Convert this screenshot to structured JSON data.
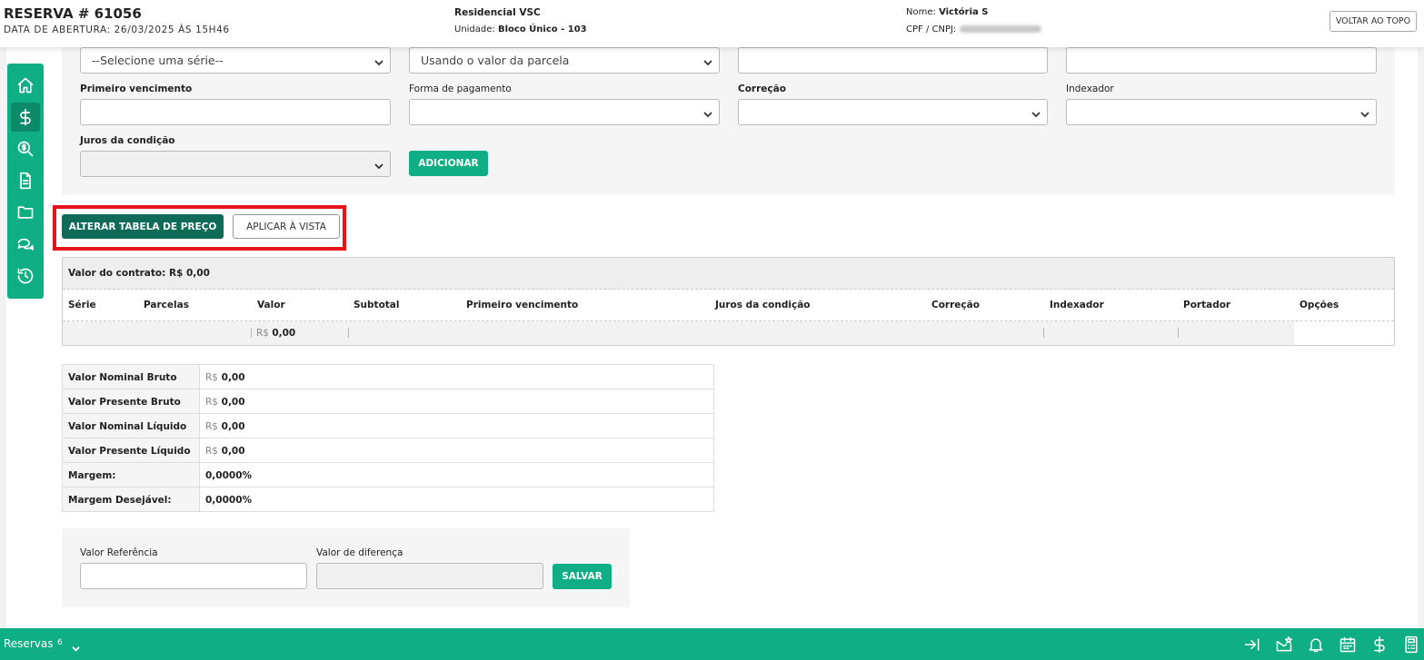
{
  "header": {
    "reserva_title": "RESERVA # 61056",
    "abertura": "DATA DE ABERTURA: 26/03/2025 ÀS 15H46",
    "empreendimento": "Residencial VSC",
    "unidade_label": "Unidade:",
    "unidade_value": "Bloco Único - 103",
    "nome_label": "Nome:",
    "nome_value": "Victória S",
    "cpf_label": "CPF / CNPJ:",
    "top_button": "VOLTAR AO TOPO"
  },
  "form": {
    "serie_select": "--Selecione uma série--",
    "valor_select": "Usando o valor da parcela",
    "primeiro_vencimento_label": "Primeiro vencimento",
    "forma_pagamento_label": "Forma de pagamento",
    "correcao_label": "Correção",
    "indexador_label": "Indexador",
    "juros_label": "Juros da condição",
    "adicionar_button": "ADICIONAR"
  },
  "actions": {
    "alterar_tabela": "ALTERAR TABELA DE PREÇO",
    "aplicar_vista": "APLICAR À VISTA"
  },
  "contract_table": {
    "valor_contrato": "Valor do contrato: R$ 0,00",
    "columns": [
      "Série",
      "Parcelas",
      "Valor",
      "Subtotal",
      "Primeiro vencimento",
      "Juros da condição",
      "Correção",
      "Indexador",
      "Portador",
      "Opções"
    ],
    "total_currency": "R$",
    "total_value": "0,00"
  },
  "values_table": [
    {
      "label": "Valor Nominal Bruto",
      "currency": "R$",
      "value": "0,00"
    },
    {
      "label": "Valor Presente Bruto",
      "currency": "R$",
      "value": "0,00"
    },
    {
      "label": "Valor Nominal Líquido",
      "currency": "R$",
      "value": "0,00"
    },
    {
      "label": "Valor Presente Líquido",
      "currency": "R$",
      "value": "0,00"
    },
    {
      "label": "Margem:",
      "currency": "",
      "value": "0,0000%"
    },
    {
      "label": "Margem Desejável:",
      "currency": "",
      "value": "0,0000%"
    }
  ],
  "reference": {
    "valor_referencia_label": "Valor Referência",
    "valor_diferenca_label": "Valor de diferença",
    "salvar_button": "SALVAR"
  },
  "bottom_bar": {
    "label": "Reservas",
    "count": "6"
  },
  "colors": {
    "accent": "#0fae84",
    "accent_dark": "#0d6b58",
    "highlight": "#e4141b"
  },
  "icons": {
    "sidebar": [
      "home-icon",
      "dollar-icon",
      "search-dollar-icon",
      "document-icon",
      "folder-icon",
      "chat-icon",
      "history-icon"
    ],
    "bottom": [
      "arrow-right-bar-icon",
      "mail-star-icon",
      "bell-icon",
      "calendar-icon",
      "dollar-icon",
      "calculator-icon"
    ]
  }
}
